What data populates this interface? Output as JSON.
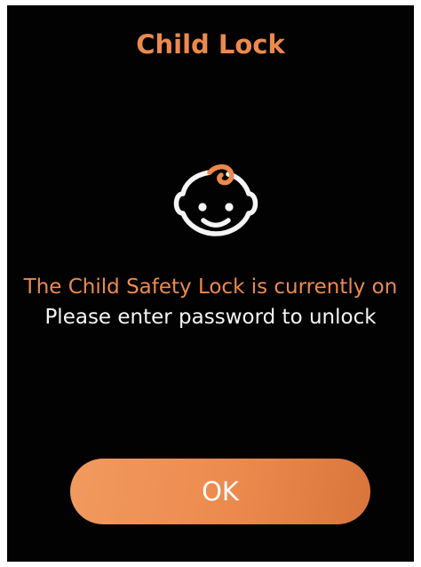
{
  "dialog": {
    "title": "Child Lock",
    "icon": "baby-face-icon",
    "status_text": "The Child Safety Lock is currently on",
    "instruction_text": "Please enter password to unlock",
    "ok_label": "OK"
  },
  "colors": {
    "background": "#020202",
    "accent": "#ec8a4e",
    "accent_light": "#f19a5f",
    "accent_dark": "#d9753a",
    "text_primary": "#f4f4f4"
  }
}
